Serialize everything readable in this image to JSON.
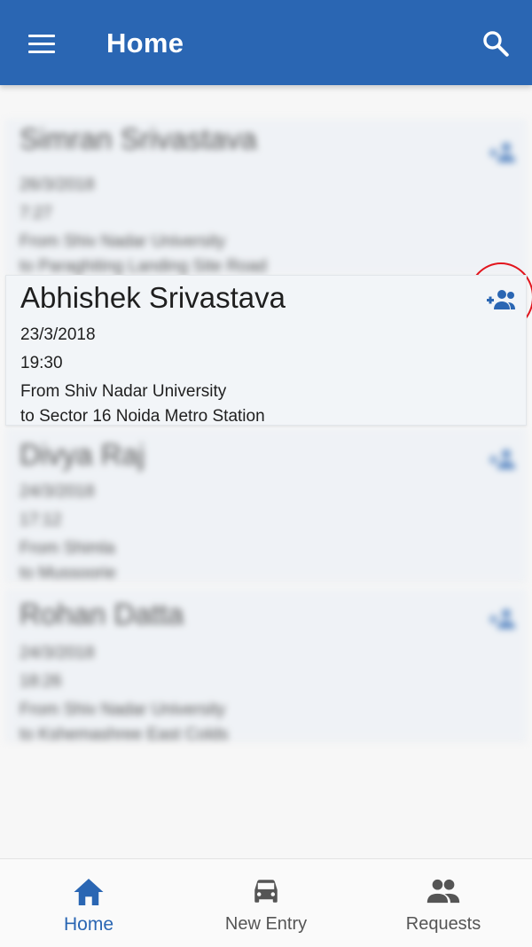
{
  "appbar": {
    "title": "Home"
  },
  "cards": [
    {
      "name": "Simran Srivastava",
      "date": "26/3/2018",
      "time": "7:27",
      "from": "From Shiv Nadar University",
      "to": "to Paraghiting Landing Site Road",
      "blurred": true
    },
    {
      "name": "Abhishek Srivastava",
      "date": "23/3/2018",
      "time": "19:30",
      "from": "From Shiv Nadar University",
      "to": "to Sector 16 Noida Metro Station",
      "blurred": false
    },
    {
      "name": "Divya Raj",
      "date": "24/3/2018",
      "time": "17:12",
      "from": "From Shimla",
      "to": "to Mussoorie",
      "blurred": true
    },
    {
      "name": "Rohan Datta",
      "date": "24/3/2018",
      "time": "18:26",
      "from": "From Shiv Nadar University",
      "to": "to Kshemashree East Colds",
      "blurred": true
    }
  ],
  "bottom_nav": [
    {
      "label": "Home",
      "icon": "home-icon",
      "active": true
    },
    {
      "label": "New Entry",
      "icon": "car-icon",
      "active": false
    },
    {
      "label": "Requests",
      "icon": "people-icon",
      "active": false
    }
  ],
  "colors": {
    "primary": "#2a66b3",
    "highlight_ring": "#e2151d"
  }
}
